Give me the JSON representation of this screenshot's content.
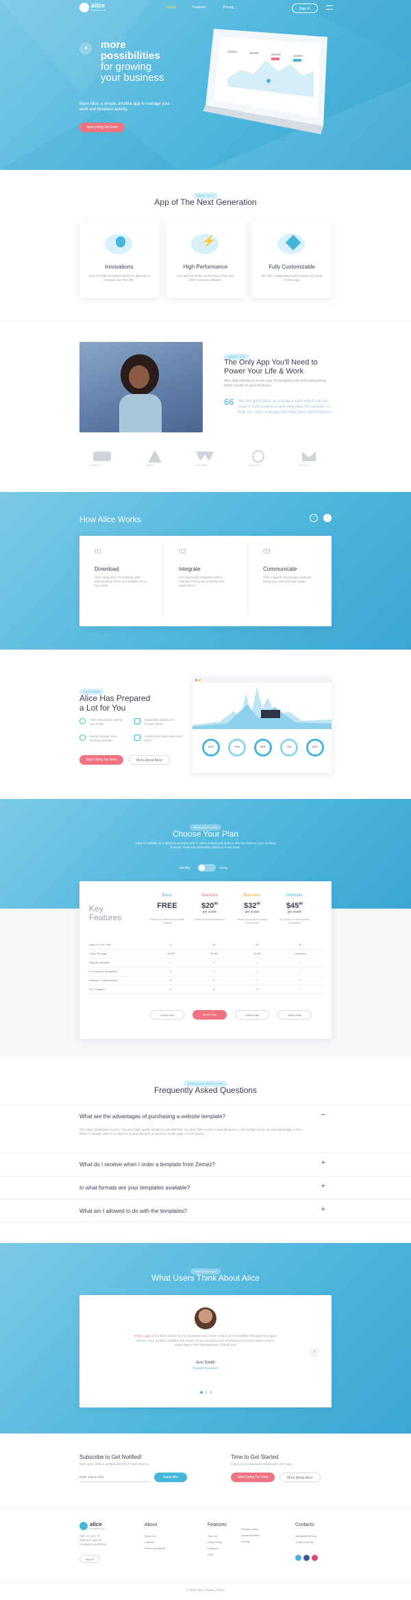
{
  "header": {
    "logo": "alice",
    "logo_sub": "BUSINESS APP",
    "nav": [
      "Home",
      "Features",
      "Pricing"
    ],
    "signin": "Sign In"
  },
  "hero": {
    "line1": "more",
    "line2": "possibilities",
    "line3": "for growing",
    "line4": "your business",
    "desc": "Meet Alice, a simple, intuitive app to manage your work and business activity.",
    "cta": "Start Using For Free"
  },
  "features": {
    "pill": "WHAT IS IT",
    "title": "App of The Next Generation",
    "items": [
      {
        "title": "Innovations",
        "text": "Alice is a fully innovative business app built to increase your benefits."
      },
      {
        "title": "High Performance",
        "text": "Our app has better performance than any other business software."
      },
      {
        "title": "Fully Customizable",
        "text": "We offer outstanding customization as a part of Alice app."
      }
    ]
  },
  "about": {
    "pill": "ABOUT APP",
    "title": "The Only App You'll Need to Power Your Life & Work",
    "text": "Alice App introduces a new way of managing your work and getting better results for your business.",
    "quote": "We designed Alice as a unique tool, which can be used in both business and everyday life spheres to help our users manage the daily basis performance.",
    "logos": [
      "TRIANGLE",
      "VERTEX",
      "WINDTURBO",
      "HEXAGON",
      "BUTTERFLY"
    ]
  },
  "how": {
    "title": "How Alice Works",
    "steps": [
      {
        "num": "01",
        "title": "Download",
        "text": "Start using Alice immediately after downloading it from our website just in two clicks."
      },
      {
        "num": "02",
        "title": "Integrate",
        "text": "Our app easily integrates with a majority of business software and applications."
      },
      {
        "num": "03",
        "title": "Communicate",
        "text": "Alice supports Passenger protocols letting you communicate easily."
      }
    ]
  },
  "prepared": {
    "pill": "FEATURES",
    "title1": "Alice Has Prepared",
    "title2": "a Lot for You",
    "items": [
      "Find new people quickly and easily",
      "Expanded statistics in simple charts",
      "Easily manage your working process",
      "Create new tasks and solve them"
    ],
    "cta1": "Start Using For Free",
    "cta2": "More About Alice",
    "gauges": [
      "62%",
      "79%",
      "54%",
      "71%",
      "63%"
    ]
  },
  "pricing": {
    "pill": "PRICING PLANS",
    "title": "Choose Your Plan",
    "desc": "Alice is available in 4 different versions with or without additional options that can improve your working process. Read the information below to know more.",
    "toggle_left": "Monthly",
    "toggle_right": "Yearly",
    "key_title": "Key Features",
    "plans": [
      {
        "name": "Basic",
        "price": "FREE",
        "per": "",
        "note": "Perfect for startups and small projects",
        "color": "#46b5dc",
        "btn": "Select Plan"
      },
      {
        "name": "Standard",
        "price": "$20",
        "cents": "99",
        "per": "per month",
        "note": "Great for small businesses",
        "color": "#f07381",
        "btn": "Select Plan"
      },
      {
        "name": "Business",
        "price": "$32",
        "cents": "99",
        "per": "per month",
        "note": "Perfect for small and large businesses",
        "color": "#f0a23b",
        "btn": "Select Plan"
      },
      {
        "name": "Premium",
        "price": "$45",
        "cents": "99",
        "per": "per month",
        "note": "#1 choice for international companies",
        "color": "#46b5dc",
        "btn": "Select Plan"
      }
    ],
    "rows": [
      {
        "label": "Days of Free Trial",
        "vals": [
          "8",
          "15",
          "30",
          "45"
        ]
      },
      {
        "label": "Cloud Storage",
        "vals": [
          "15 GB",
          "20 GB",
          "40 GB",
          "Unlimited"
        ]
      },
      {
        "label": "Regular Updates",
        "vals": [
          "✓",
          "✓",
          "✓",
          "✓"
        ]
      },
      {
        "label": "eCommerce Integration",
        "vals": [
          "✕",
          "✓",
          "✓",
          "✓"
        ]
      },
      {
        "label": "Interface Customization",
        "vals": [
          "✕",
          "✕",
          "✓",
          "✓"
        ]
      },
      {
        "label": "24/7 Support",
        "vals": [
          "✕",
          "✕",
          "✕",
          "✓"
        ]
      }
    ]
  },
  "faq": {
    "pill": "FREQUENT QUESTIONS",
    "title": "Frequently Asked Questions",
    "items": [
      {
        "q": "What are the advantages of purchasing a website template?",
        "a": "The major advantage is price: You get a high quality design for just $20-$70. You don't have to hire a web designer or web design studio. Second advantage is time frame: It usually takes 5-15 days for a good designer to produce a web page of such quality.",
        "icon": "−"
      },
      {
        "q": "What do I receive when I order a template from Zemez?",
        "icon": "+"
      },
      {
        "q": "In what formats are your templates available?",
        "icon": "+"
      },
      {
        "q": "What am I allowed to do with the templates?",
        "icon": "+"
      }
    ]
  },
  "testimonials": {
    "pill": "TESTIMONIALS",
    "title": "What Users Think About Alice",
    "quote_tag": "#Alice_app",
    "quote": " is the best choice for my business and I have tried a lot of workflow management apps before. Your product satisfies the needs of my company and its employees to the fullest extent, especially in HR management. Thank you!",
    "name": "Ann Smith",
    "role": "Regular Customer"
  },
  "subscribe": {
    "title": "Subscribe to Get Notified!",
    "text": "Sign up to receive updates and fresh news from us.",
    "placeholder": "Enter Your E-mail",
    "btn": "Subscribe"
  },
  "start": {
    "title": "Time to Get Started",
    "text": "Improve your business results with Alice app.",
    "cta1": "Start Using For Free",
    "cta2": "More About Alice"
  },
  "footer": {
    "logo": "alice",
    "logo_sub": "BUSINESS APP",
    "about": "Alice is your #1 business app for managing workflow.",
    "signin": "Sign In",
    "cols": [
      {
        "h": "About",
        "items": [
          "About Us",
          "Careers",
          "Press and Media"
        ]
      },
      {
        "h": "Features",
        "items": [
          "Sign Up",
          "Online Help",
          "Features",
          "FAQ"
        ]
      },
      {
        "h": "",
        "items": [
          "Privacy policy",
          "Documentation",
          "Pricing"
        ]
      },
      {
        "h": "Contacts",
        "items": [
          "info@alicebiz.org",
          "1-800-1234-56"
        ]
      }
    ],
    "copy": "© 2018 Alice. Privacy Policy"
  }
}
